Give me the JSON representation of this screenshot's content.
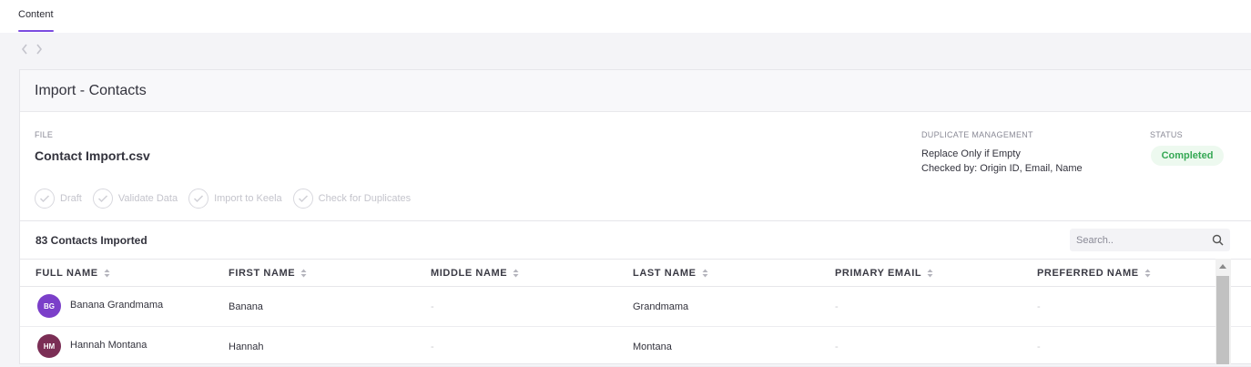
{
  "tabs": [
    {
      "label": "Content",
      "active": true
    }
  ],
  "nav": {
    "back_icon": "chevron-left-icon",
    "forward_icon": "chevron-right-icon"
  },
  "card": {
    "title": "Import - Contacts"
  },
  "file": {
    "label": "FILE",
    "name": "Contact Import.csv"
  },
  "steps": [
    {
      "label": "Draft",
      "icon": "check-icon"
    },
    {
      "label": "Validate Data",
      "icon": "check-icon"
    },
    {
      "label": "Import to Keela",
      "icon": "check-icon"
    },
    {
      "label": "Check for Duplicates",
      "icon": "check-icon"
    }
  ],
  "duplicate": {
    "label": "DUPLICATE MANAGEMENT",
    "line1": "Replace Only if Empty",
    "line2": "Checked by: Origin ID, Email, Name"
  },
  "status": {
    "label": "STATUS",
    "value": "Completed",
    "color": "#35a854",
    "bg": "#edf9ef"
  },
  "list": {
    "count_label": "83 Contacts Imported",
    "search_placeholder": "Search..",
    "search_icon": "search-icon"
  },
  "columns": [
    "FULL NAME",
    "FIRST NAME",
    "MIDDLE NAME",
    "LAST NAME",
    "PRIMARY EMAIL",
    "PREFERRED NAME"
  ],
  "rows": [
    {
      "initials": "BG",
      "avatar_color": "#7b3fc9",
      "full_name": "Banana Grandmama",
      "first_name": "Banana",
      "middle_name": "-",
      "last_name": "Grandmama",
      "email": "-",
      "preferred": "-"
    },
    {
      "initials": "HM",
      "avatar_color": "#7b2e55",
      "full_name": "Hannah Montana",
      "first_name": "Hannah",
      "middle_name": "-",
      "last_name": "Montana",
      "email": "-",
      "preferred": "-"
    }
  ],
  "colors": {
    "accent": "#7b4ce0"
  }
}
